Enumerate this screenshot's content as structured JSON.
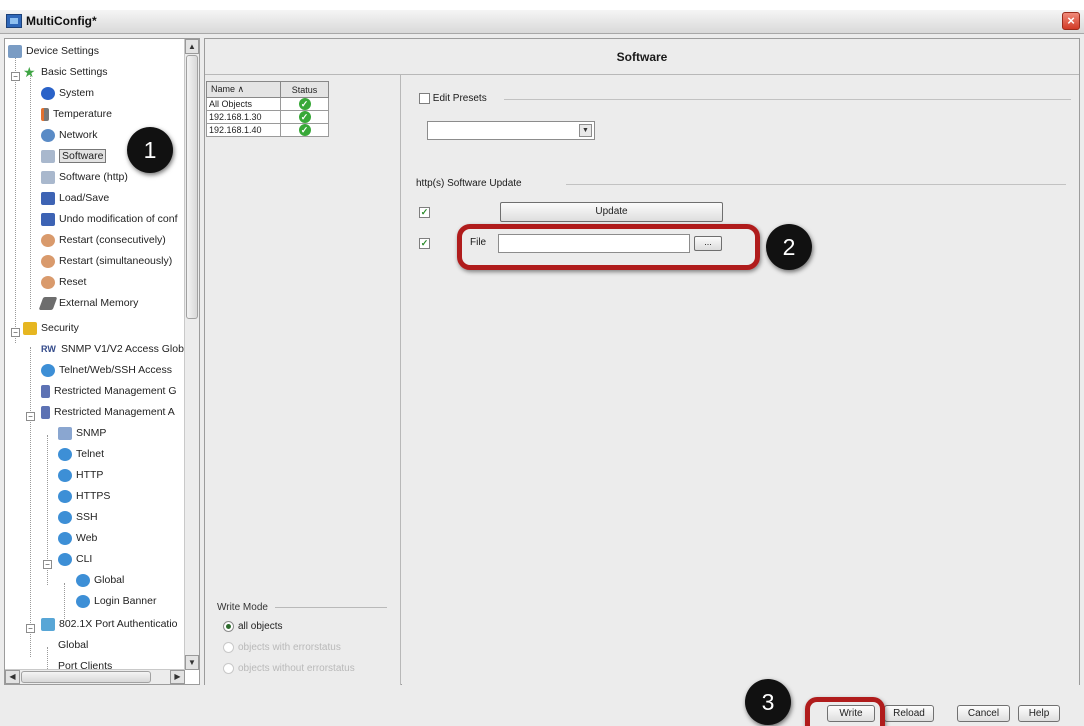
{
  "window": {
    "title": "MultiConfig*",
    "close_label": "×"
  },
  "tree": {
    "items": [
      {
        "label": "Device Settings",
        "icon": "settings-icon"
      },
      {
        "label": "Basic Settings",
        "icon": "star-icon"
      },
      {
        "label": "System",
        "icon": "info-icon"
      },
      {
        "label": "Temperature",
        "icon": "thermometer-icon"
      },
      {
        "label": "Network",
        "icon": "network-icon"
      },
      {
        "label": "Software",
        "icon": "software-icon"
      },
      {
        "label": "Software (http)",
        "icon": "software-icon"
      },
      {
        "label": "Load/Save",
        "icon": "disk-icon"
      },
      {
        "label": "Undo modification of conf",
        "icon": "disk-icon"
      },
      {
        "label": "Restart (consecutively)",
        "icon": "restart-icon"
      },
      {
        "label": "Restart (simultaneously)",
        "icon": "restart-icon"
      },
      {
        "label": "Reset",
        "icon": "restart-icon"
      },
      {
        "label": "External Memory",
        "icon": "memory-card-icon"
      },
      {
        "label": "Security",
        "icon": "lock-icon"
      },
      {
        "label": "SNMP V1/V2 Access Glob",
        "icon": "snmp-icon"
      },
      {
        "label": "Telnet/Web/SSH Access",
        "icon": "globe-icon"
      },
      {
        "label": "Restricted Management G",
        "icon": "shield-icon"
      },
      {
        "label": "Restricted Management A",
        "icon": "shield-icon"
      },
      {
        "label": "SNMP",
        "icon": "snmp-icon"
      },
      {
        "label": "Telnet",
        "icon": "globe-icon"
      },
      {
        "label": "HTTP",
        "icon": "globe-icon"
      },
      {
        "label": "HTTPS",
        "icon": "globe-icon"
      },
      {
        "label": "SSH",
        "icon": "globe-icon"
      },
      {
        "label": "Web",
        "icon": "globe-icon"
      },
      {
        "label": "CLI",
        "icon": "globe-icon"
      },
      {
        "label": "Global",
        "icon": "globe-icon"
      },
      {
        "label": "Login Banner",
        "icon": "globe-icon"
      },
      {
        "label": "802.1X Port Authenticatio",
        "icon": "users-icon"
      },
      {
        "label": "Global",
        "icon": "window-icon"
      },
      {
        "label": "Port Clients",
        "icon": "window-icon"
      }
    ],
    "snmp_badge": "RW"
  },
  "content": {
    "title": "Software"
  },
  "objects": {
    "col_name": "Name ∧",
    "col_status": "Status",
    "rows": [
      {
        "name": "All Objects",
        "status": "✓"
      },
      {
        "name": "192.168.1.30",
        "status": "✓"
      },
      {
        "name": "192.168.1.40",
        "status": "✓"
      }
    ]
  },
  "write_mode": {
    "legend": "Write Mode",
    "options": [
      {
        "label": "all objects",
        "selected": true,
        "disabled": false
      },
      {
        "label": "objects with errorstatus",
        "selected": false,
        "disabled": true
      },
      {
        "label": "objects without errorstatus",
        "selected": false,
        "disabled": true
      }
    ]
  },
  "settings": {
    "edit_presets_label": "Edit Presets",
    "edit_presets_checked": false,
    "preset_combo_value": "",
    "combo_arrow": "▼",
    "update_section_label": "http(s) Software Update",
    "update_button": "Update",
    "update_checked": true,
    "file_checked": true,
    "file_label": "File",
    "file_value": "",
    "browse_button": "...",
    "check_mark": "✓"
  },
  "buttons": {
    "write": "Write",
    "reload": "Reload",
    "cancel": "Cancel",
    "help": "Help"
  },
  "callouts": [
    "1",
    "2",
    "3"
  ],
  "colors": {
    "highlight": "#b01c1c",
    "callout": "#111111",
    "status_ok": "#38a838"
  }
}
